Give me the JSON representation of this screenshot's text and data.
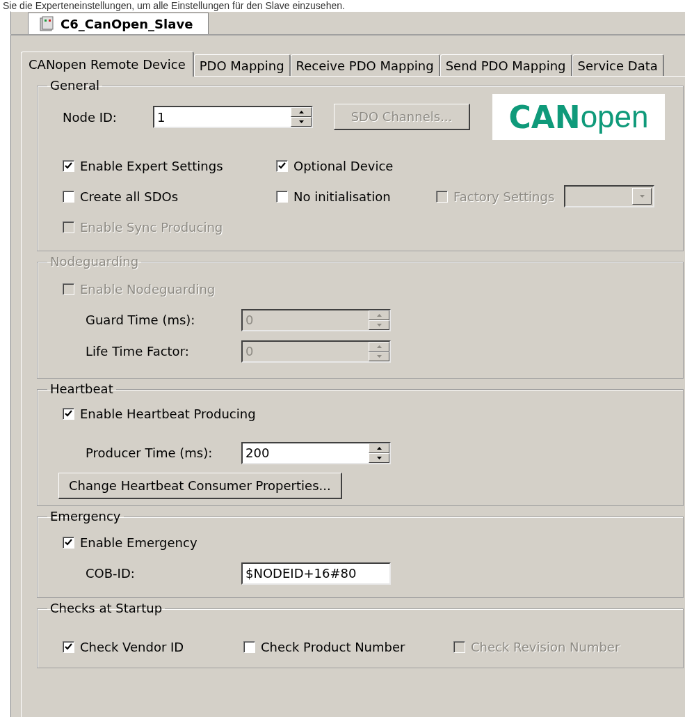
{
  "caption": "Sie die Experteneinstellungen, um alle Einstellungen für den Slave einzusehen.",
  "document_tab": {
    "title": "C6_CanOpen_Slave",
    "selected": true
  },
  "tabs": [
    {
      "label": "CANopen Remote Device",
      "selected": true
    },
    {
      "label": "PDO Mapping",
      "selected": false
    },
    {
      "label": "Receive PDO Mapping",
      "selected": false
    },
    {
      "label": "Send PDO Mapping",
      "selected": false
    },
    {
      "label": "Service Data",
      "selected": false
    }
  ],
  "general": {
    "title": "General",
    "node_id": {
      "label": "Node ID:",
      "value": "1"
    },
    "sdo_button": {
      "label": "SDO Channels...",
      "disabled": true
    },
    "logo": {
      "strong": "CAN",
      "light": "open"
    },
    "option_rows": [
      [
        {
          "label": "Enable Expert Settings",
          "checked": true,
          "disabled": false
        },
        {
          "label": "Optional Device",
          "checked": true,
          "disabled": false
        }
      ],
      [
        {
          "label": "Create all SDOs",
          "checked": false,
          "disabled": false
        },
        {
          "label": "No initialisation",
          "checked": false,
          "disabled": false
        },
        {
          "label": "Factory Settings",
          "checked": false,
          "disabled": true
        }
      ],
      [
        {
          "label": "Enable Sync Producing",
          "checked": false,
          "disabled": true
        }
      ]
    ],
    "factory_select": {
      "disabled": true
    }
  },
  "nodeguarding": {
    "title": "Nodeguarding",
    "disabled": true,
    "enable": {
      "label": "Enable Nodeguarding",
      "checked": false,
      "disabled": true
    },
    "fields": [
      {
        "label": "Guard Time (ms):",
        "value": "0",
        "kind": "spin",
        "disabled": true
      },
      {
        "label": "Life Time Factor:",
        "value": "0",
        "kind": "spin",
        "disabled": true
      }
    ]
  },
  "heartbeat": {
    "title": "Heartbeat",
    "enable": {
      "label": "Enable Heartbeat Producing",
      "checked": true,
      "disabled": false
    },
    "fields": [
      {
        "label": "Producer Time (ms):",
        "value": "200",
        "kind": "spin",
        "disabled": false
      }
    ],
    "button": "Change Heartbeat Consumer Properties..."
  },
  "emergency": {
    "title": "Emergency",
    "enable": {
      "label": "Enable Emergency",
      "checked": true,
      "disabled": false
    },
    "fields": [
      {
        "label": "COB-ID:",
        "value": "$NODEID+16#80",
        "kind": "text",
        "disabled": false
      }
    ]
  },
  "checks": {
    "title": "Checks at Startup",
    "options": [
      {
        "label": "Check Vendor ID",
        "checked": true,
        "disabled": false
      },
      {
        "label": "Check Product Number",
        "checked": false,
        "disabled": false
      },
      {
        "label": "Check Revision Number",
        "checked": false,
        "disabled": true
      }
    ]
  }
}
